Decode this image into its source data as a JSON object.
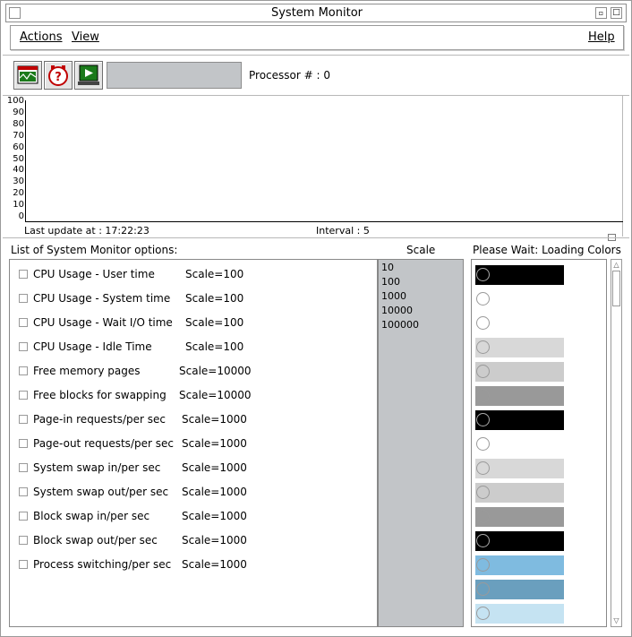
{
  "window": {
    "title": "System Monitor"
  },
  "menu": {
    "actions": "Actions",
    "view": "View",
    "help": "Help"
  },
  "toolbar": {
    "processor_label": "Processor # : 0"
  },
  "graph": {
    "y_ticks": [
      "100",
      "90",
      "80",
      "70",
      "60",
      "50",
      "40",
      "30",
      "20",
      "10",
      "0"
    ],
    "last_update": "Last update at : 17:22:23",
    "interval": "Interval :   5"
  },
  "panel": {
    "list_header": "List of System Monitor options:",
    "scale_header": "Scale",
    "colors_header": "Please Wait: Loading Colors"
  },
  "options": [
    {
      "label": "CPU Usage - User time",
      "scale": "Scale=100"
    },
    {
      "label": "CPU Usage - System time",
      "scale": "Scale=100"
    },
    {
      "label": "CPU Usage - Wait I/O time",
      "scale": "Scale=100"
    },
    {
      "label": "CPU Usage - Idle Time",
      "scale": "Scale=100"
    },
    {
      "label": "Free memory pages",
      "scale": "Scale=10000"
    },
    {
      "label": "Free blocks for swapping",
      "scale": "Scale=10000"
    },
    {
      "label": "Page-in requests/per sec",
      "scale": "Scale=1000"
    },
    {
      "label": "Page-out requests/per sec",
      "scale": "Scale=1000"
    },
    {
      "label": "System swap in/per sec",
      "scale": "Scale=1000"
    },
    {
      "label": "System swap out/per sec",
      "scale": "Scale=1000"
    },
    {
      "label": "Block swap in/per sec",
      "scale": "Scale=1000"
    },
    {
      "label": "Block swap out/per sec",
      "scale": "Scale=1000"
    },
    {
      "label": "Process switching/per sec",
      "scale": "Scale=1000"
    }
  ],
  "scale_options": [
    "10",
    "100",
    "1000",
    "10000",
    "100000"
  ],
  "colors": [
    "#000000",
    "#ffffff",
    "#ffffff",
    "#d8d8d8",
    "#cccccc",
    "#999999",
    "#000000",
    "#ffffff",
    "#d8d8d8",
    "#cccccc",
    "#999999",
    "#000000",
    "#7fbbe0",
    "#6a9fbe",
    "#c5e3f2"
  ]
}
